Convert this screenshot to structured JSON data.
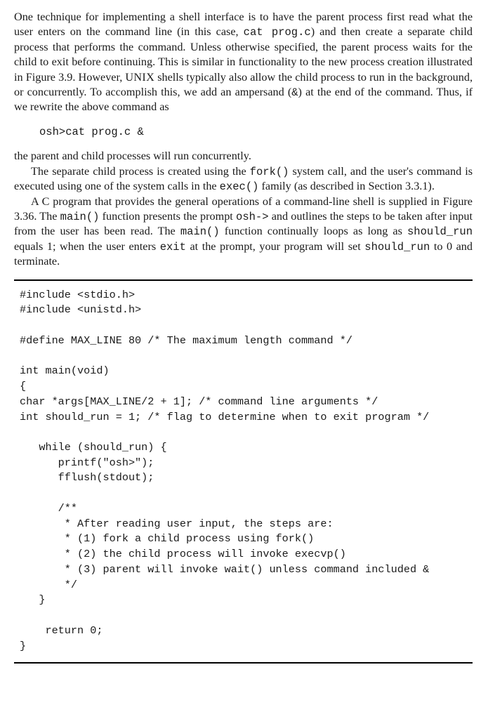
{
  "p1_a": "One technique for implementing a shell interface is to have the parent process first read what the user enters on the command line (in this case, ",
  "p1_code1": "cat prog.c",
  "p1_b": ") and then create a separate child process that performs the command. Unless otherwise specified, the parent process waits for the child to exit before continuing. This is similar in functionality to the new process creation illustrated in Figure 3.9. However, ",
  "p1_sc": "UNIX",
  "p1_c": " shells typically also allow the child process to run in the background, or concurrently. To accomplish this, we add an ampersand (",
  "p1_code2": "&",
  "p1_d": ") at the end of the command. Thus, if we rewrite the above command as",
  "cmd": "osh>cat prog.c &",
  "p2": "the parent and child processes will run concurrently.",
  "p3_a": "The separate child process is created using the ",
  "p3_code1": "fork()",
  "p3_b": " system call, and the user's command is executed using one of the system calls in the ",
  "p3_code2": "exec()",
  "p3_c": " family (as described in Section 3.3.1).",
  "p4_a": "A C program that provides the general operations of a command-line shell is supplied in Figure 3.36. The ",
  "p4_code1": "main()",
  "p4_b": " function presents the prompt ",
  "p4_code2": "osh->",
  "p4_c": " and outlines the steps to be taken after input from the user has been read. The ",
  "p4_code3": "main()",
  "p4_d": " function continually loops as long as ",
  "p4_code4": "should_run",
  "p4_e": " equals 1; when the user enters ",
  "p4_code5": "exit",
  "p4_f": " at the prompt, your program will set ",
  "p4_code6": "should_run",
  "p4_g": " to 0 and terminate.",
  "code": "#include <stdio.h>\n#include <unistd.h>\n\n#define MAX_LINE 80 /* The maximum length command */\n\nint main(void)\n{\nchar *args[MAX_LINE/2 + 1]; /* command line arguments */\nint should_run = 1; /* flag to determine when to exit program */\n\n   while (should_run) {\n      printf(\"osh>\");\n      fflush(stdout);\n\n      /**\n       * After reading user input, the steps are:\n       * (1) fork a child process using fork()\n       * (2) the child process will invoke execvp()\n       * (3) parent will invoke wait() unless command included &\n       */\n   }\n\n    return 0;\n}"
}
